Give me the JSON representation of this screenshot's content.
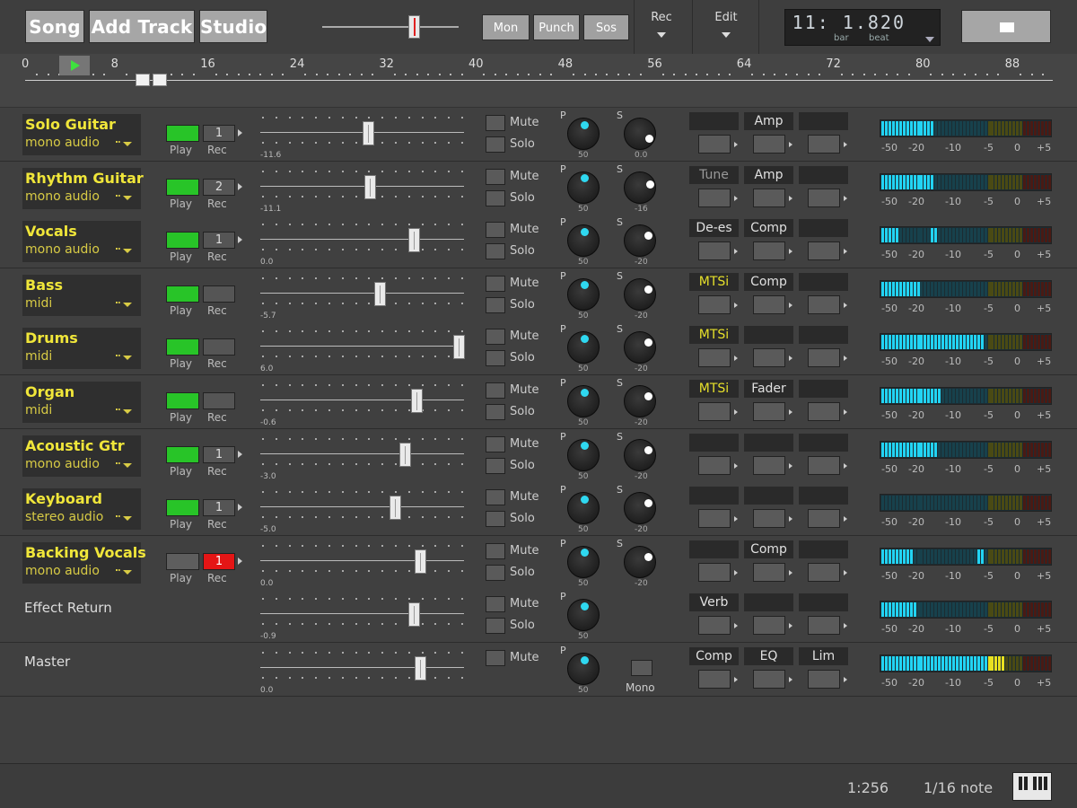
{
  "toolbar": {
    "buttons": [
      {
        "name": "song-button",
        "label": "Song"
      },
      {
        "name": "add-track-button",
        "label": "Add Track"
      },
      {
        "name": "studio-button",
        "label": "Studio"
      }
    ],
    "transport_buttons": [
      {
        "name": "mon-button",
        "label": "Mon"
      },
      {
        "name": "punch-button",
        "label": "Punch"
      },
      {
        "name": "sos-button",
        "label": "Sos"
      }
    ],
    "rec_menu": "Rec",
    "edit_menu": "Edit",
    "position_value": "11: 1.820",
    "position_units": [
      "bar",
      "beat"
    ],
    "scrub_position": 0.67,
    "stop_icon": "stop-square-icon"
  },
  "ruler": {
    "bars": [
      "0",
      "8",
      "16",
      "24",
      "32",
      "40",
      "48",
      "56",
      "64",
      "72",
      "80",
      "88"
    ],
    "play_icon": "play-triangle-icon"
  },
  "tracks": [
    {
      "name": "Solo Guitar",
      "type": "mono audio",
      "play": true,
      "rec": "1",
      "armed": false,
      "fader": 0.52,
      "fader_val": "-11.6",
      "pan_val": "50",
      "pan_frac": 0.5,
      "send_val": "0.0",
      "send_frac": 0.93,
      "send_label": "S",
      "fx": [
        "",
        "Amp",
        ""
      ],
      "fx_style": [
        "",
        "",
        ""
      ],
      "meter": {
        "lo": 0.3,
        "peak": null,
        "hot": null
      }
    },
    {
      "name": "Rhythm Guitar",
      "type": "mono audio",
      "play": true,
      "rec": "2",
      "armed": false,
      "fader": 0.53,
      "fader_val": "-11.1",
      "pan_val": "50",
      "pan_frac": 0.5,
      "send_val": "-16",
      "send_frac": 0.75,
      "send_label": "S",
      "fx": [
        "Tune",
        "Amp",
        ""
      ],
      "fx_style": [
        "dim",
        "",
        ""
      ],
      "meter": {
        "lo": 0.3,
        "peak": null,
        "hot": null
      }
    },
    {
      "name": "Vocals",
      "type": "mono audio",
      "play": true,
      "rec": "1",
      "armed": false,
      "fader": 0.76,
      "fader_val": "0.0",
      "pan_val": "50",
      "pan_frac": 0.5,
      "send_val": "-20",
      "send_frac": 0.7,
      "send_label": "S",
      "fx": [
        "De-es",
        "Comp",
        ""
      ],
      "fx_style": [
        "",
        "",
        ""
      ],
      "meter": {
        "lo": 0.1,
        "peak": 0.31,
        "hot": null
      }
    },
    {
      "name": "Bass",
      "type": "midi",
      "play": true,
      "rec": "",
      "armed": false,
      "fader": 0.58,
      "fader_val": "-5.7",
      "pan_val": "50",
      "pan_frac": 0.5,
      "send_val": "-20",
      "send_frac": 0.7,
      "send_label": "S",
      "fx": [
        "MTSi",
        "Comp",
        ""
      ],
      "fx_style": [
        "yel",
        "",
        ""
      ],
      "meter": {
        "lo": 0.22,
        "peak": null,
        "hot": null
      }
    },
    {
      "name": "Drums",
      "type": "midi",
      "play": true,
      "rec": "",
      "armed": false,
      "fader": 0.99,
      "fader_val": "6.0",
      "pan_val": "50",
      "pan_frac": 0.5,
      "send_val": "-20",
      "send_frac": 0.7,
      "send_label": "S",
      "fx": [
        "MTSi",
        "",
        ""
      ],
      "fx_style": [
        "yel",
        "",
        ""
      ],
      "meter": {
        "lo": 0.6,
        "peak": null,
        "hot": null
      }
    },
    {
      "name": "Organ",
      "type": "midi",
      "play": true,
      "rec": "",
      "armed": false,
      "fader": 0.77,
      "fader_val": "-0.6",
      "pan_val": "50",
      "pan_frac": 0.5,
      "send_val": "-20",
      "send_frac": 0.7,
      "send_label": "S",
      "fx": [
        "MTSi",
        "Fader",
        ""
      ],
      "fx_style": [
        "yel",
        "",
        ""
      ],
      "meter": {
        "lo": 0.35,
        "peak": null,
        "hot": null
      }
    },
    {
      "name": "Acoustic Gtr",
      "type": "mono audio",
      "play": true,
      "rec": "1",
      "armed": false,
      "fader": 0.71,
      "fader_val": "-3.0",
      "pan_val": "50",
      "pan_frac": 0.5,
      "send_val": "-20",
      "send_frac": 0.7,
      "send_label": "S",
      "fx": [
        "",
        "",
        ""
      ],
      "fx_style": [
        "",
        "",
        ""
      ],
      "meter": {
        "lo": 0.33,
        "peak": null,
        "hot": null
      }
    },
    {
      "name": "Keyboard",
      "type": "stereo audio",
      "play": true,
      "rec": "1",
      "armed": false,
      "fader": 0.66,
      "fader_val": "-5.0",
      "pan_val": "50",
      "pan_frac": 0.5,
      "send_val": "-20",
      "send_frac": 0.7,
      "send_label": "S",
      "fx": [
        "",
        "",
        ""
      ],
      "fx_style": [
        "",
        "",
        ""
      ],
      "meter": {
        "lo": 0.0,
        "peak": null,
        "hot": null
      }
    },
    {
      "name": "Backing Vocals",
      "type": "mono audio",
      "play": false,
      "rec": "1",
      "armed": true,
      "fader": 0.79,
      "fader_val": "0.0",
      "pan_val": "50",
      "pan_frac": 0.5,
      "send_val": "-20",
      "send_frac": 0.7,
      "send_label": "S",
      "fx": [
        "",
        "Comp",
        ""
      ],
      "fx_style": [
        "",
        "",
        ""
      ],
      "meter": {
        "lo": 0.18,
        "peak": 0.58,
        "hot": null
      }
    },
    {
      "name": "Effect Return",
      "type": "",
      "play": null,
      "rec": null,
      "armed": false,
      "fader": 0.76,
      "fader_val": "-0.9",
      "pan_val": "50",
      "pan_frac": 0.5,
      "send_val": "",
      "send_frac": null,
      "send_label": "",
      "fx": [
        "Verb",
        "",
        ""
      ],
      "fx_style": [
        "",
        "",
        ""
      ],
      "meter": {
        "lo": 0.2,
        "peak": null,
        "hot": null
      }
    },
    {
      "name": "Master",
      "type": "",
      "play": null,
      "rec": null,
      "armed": false,
      "fader": 0.79,
      "fader_val": "0.0",
      "pan_val": "50",
      "pan_frac": 0.5,
      "send_val": "",
      "send_frac": null,
      "send_label": "",
      "fx": [
        "Comp",
        "EQ",
        "Lim"
      ],
      "fx_style": [
        "",
        "",
        ""
      ],
      "meter": {
        "lo": 0.63,
        "peak": null,
        "hot": 0.72
      },
      "mono": "Mono"
    }
  ],
  "labels": {
    "play": "Play",
    "rec": "Rec",
    "mute": "Mute",
    "solo": "Solo",
    "pan": "P"
  },
  "meter_scale": [
    "-50",
    "-20",
    "-10",
    "-5",
    "0",
    "+5"
  ],
  "status": {
    "zoom": "1:256",
    "snap": "1/16 note",
    "piano_icon": "piano-keyboard-icon"
  },
  "colors": {
    "accent_yellow": "#f0e63a",
    "play_green": "#28c428",
    "armed_red": "#e41515",
    "knob_cyan": "#2fd8f0",
    "meter_cyan": "#22d4f4"
  }
}
